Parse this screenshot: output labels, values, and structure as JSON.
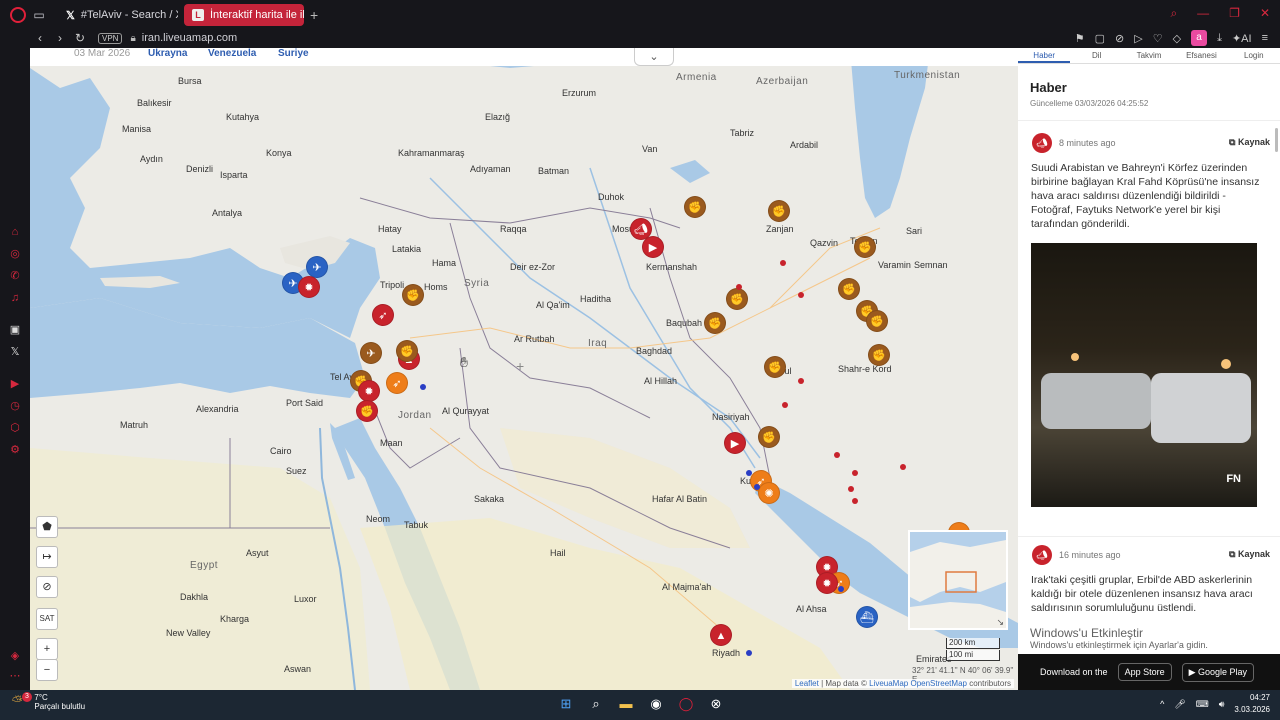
{
  "tabs": [
    {
      "label": "#TelAviv - Search / X"
    },
    {
      "label": "İnteraktif harita ile ilgili son"
    }
  ],
  "address": {
    "vpn": "VPN",
    "url": "iran.liveuamap.com"
  },
  "map": {
    "top_date": "03 Mar 2026",
    "top_links": [
      "Ukrayna",
      "Venezuela",
      "Suriye"
    ],
    "labels": {
      "balikesir": "Balıkesir",
      "bursa": "Bursa",
      "kutahya": "Kutahya",
      "manisa": "Manisa",
      "aydin": "Aydın",
      "denizli": "Denizli",
      "isparta": "Isparta",
      "antalya": "Antalya",
      "konya": "Konya",
      "kahramanmaras": "Kahramanmaraş",
      "adiyaman": "Adıyaman",
      "batman": "Batman",
      "elazig": "Elazığ",
      "hatay": "Hatay",
      "duhok": "Duhok",
      "mosul": "Mosul",
      "latakia": "Latakia",
      "hama": "Hama",
      "homs": "Homs",
      "tripoli": "Tripoli",
      "syria": "Syria",
      "deir_ez_zor": "Deir ez-Zor",
      "raqqa": "Raqqa",
      "iraq": "Iraq",
      "baghdad": "Baghdad",
      "baqubah": "Baqubah",
      "hilla": "Al Hillah",
      "rutbah": "Ar Rutbah",
      "qaim": "Al Qa'im",
      "haditha": "Haditha",
      "port_said": "Port Said",
      "alexandria": "Alexandria",
      "matruh": "Matruh",
      "cairo": "Cairo",
      "suez": "Suez",
      "tel_aviv": "Tel Aviv",
      "jordan": "Jordan",
      "maan": "Maan",
      "tabuk": "Tabuk",
      "egypt": "Egypt",
      "dakhla": "Dakhla",
      "kharga": "Kharga",
      "new_valley": "New Valley",
      "asyut": "Asyut",
      "luxor": "Luxor",
      "aswan": "Aswan",
      "nasiriyah": "Nasiriyah",
      "kuwait": "Kuwait",
      "hafar": "Hafar Al Batin",
      "dezful": "Dezful",
      "kermanshah": "Kermanshah",
      "tehran": "Tehran",
      "qazvin": "Qazvin",
      "zanjan": "Zanjan",
      "tabriz": "Tabriz",
      "ardabil": "Ardabil",
      "sari": "Sari",
      "semnan": "Semnan",
      "varamin": "Varamin",
      "shahrekord": "Shahr-e Kord",
      "riyadh": "Riyadh",
      "turkmenistan": "Turkmenistan",
      "azerbaijan": "Azerbaijan",
      "armenia": "Armenia",
      "erzurum": "Erzurum",
      "van": "Van",
      "qurayyat": "Al Qurayyat",
      "ahsa": "Al Ahsa",
      "majmaah": "Al Majma'ah",
      "hail": "Hail",
      "sakaka": "Sakaka",
      "neom": "Neom",
      "emirates": "Emirates"
    },
    "scale": {
      "km": "200 km",
      "mi": "100 mi"
    },
    "coords": "32° 21' 41.1'' N 40° 06' 39.9'' E",
    "attribution": {
      "leaflet": "Leaflet",
      "text": "| Map data ©",
      "lm": "LiveuaMap",
      "osm": "OpenStreetMap",
      "contrib": "contributors"
    },
    "controls": {
      "sat": "SAT",
      "plus": "+",
      "minus": "−"
    }
  },
  "panel": {
    "tabs": [
      "Haber",
      "Dil",
      "Takvim",
      "Efsanesi",
      "Login"
    ],
    "title": "Haber",
    "updated": "Güncelleme 03/03/2026 04:25:52",
    "news": [
      {
        "time": "8 minutes ago",
        "source": "Kaynak",
        "text": "Suudi Arabistan ve Bahreyn'i Körfez üzerinden birbirine bağlayan Kral Fahd Köprüsü'ne insansız hava aracı saldırısı düzenlendiği bildirildi - Fotoğraf, Faytuks Network'e yerel bir kişi tarafından gönderildi."
      },
      {
        "time": "16 minutes ago",
        "source": "Kaynak",
        "text": "Irak'taki çeşitli gruplar, Erbil'de ABD askerlerinin kaldığı bir otele düzenlenen insansız hava aracı saldırısının sorumluluğunu üstlendi."
      }
    ],
    "watermark": "FN",
    "win_activate": "Windows'u Etkinleştir",
    "win_activate_sub": "Windows'u etkinleştirmek için Ayarlar'a gidin.",
    "download": "Download on the",
    "appstore": "App Store",
    "googleplay": "Google Play"
  },
  "taskbar": {
    "badge": "3",
    "temp": "7°C",
    "weather": "Parçalı bulutlu",
    "time": "04:27",
    "date": "3.03.2026"
  }
}
